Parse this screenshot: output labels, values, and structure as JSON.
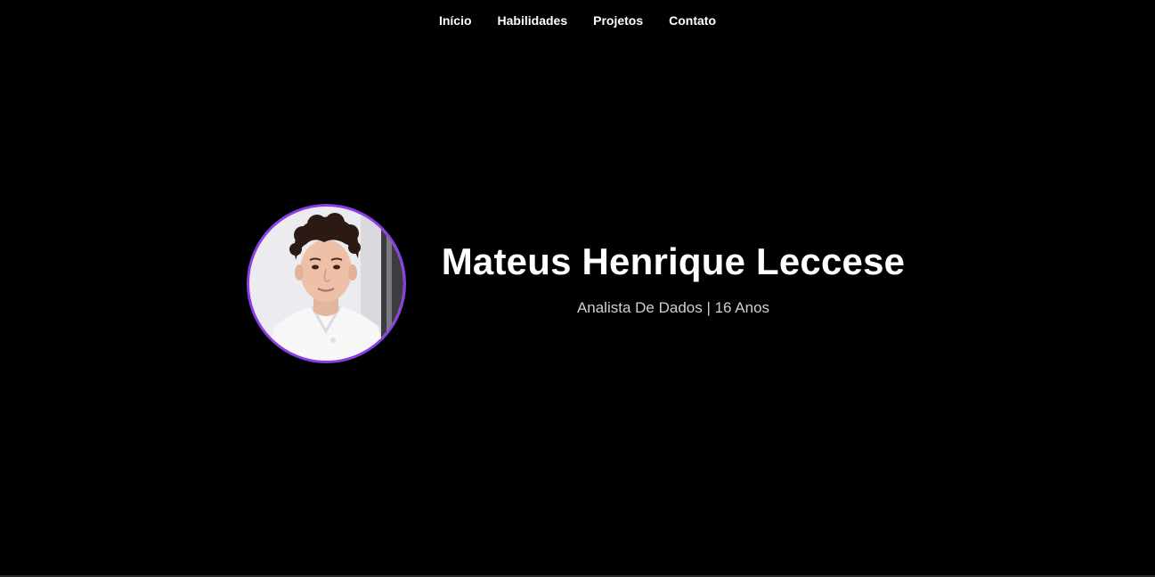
{
  "nav": {
    "items": [
      {
        "label": "Início"
      },
      {
        "label": "Habilidades"
      },
      {
        "label": "Projetos"
      },
      {
        "label": "Contato"
      }
    ]
  },
  "hero": {
    "name": "Mateus Henrique Leccese",
    "subtitle": "Analista De Dados | 16 Anos"
  },
  "colors": {
    "background": "#000000",
    "accent_border": "#8a3ee6",
    "text": "#ffffff",
    "subtitle_text": "#d0d0d0"
  }
}
